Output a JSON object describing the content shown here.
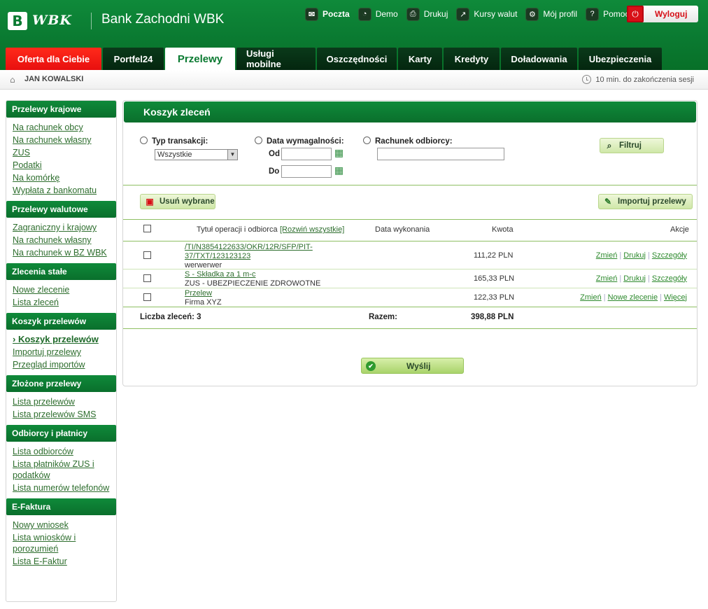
{
  "header": {
    "logo_mark": "B",
    "logo_text": "WBK",
    "bank_name": "Bank Zachodni WBK",
    "top_links": [
      {
        "label": "Poczta",
        "icon": "envelope-icon",
        "glyph": "✉",
        "bold": true
      },
      {
        "label": "Demo",
        "icon": "demo-icon",
        "glyph": "◔"
      },
      {
        "label": "Drukuj",
        "icon": "printer-icon",
        "glyph": "⎙"
      },
      {
        "label": "Kursy walut",
        "icon": "chart-icon",
        "glyph": "↗"
      },
      {
        "label": "Mój profil",
        "icon": "gear-icon",
        "glyph": "⚙"
      },
      {
        "label": "Pomoc",
        "icon": "help-icon",
        "glyph": "?"
      }
    ],
    "logout_label": "Wyloguj"
  },
  "tabs": [
    {
      "label": "Oferta dla Ciebie",
      "state": "offer"
    },
    {
      "label": "Portfel24"
    },
    {
      "label": "Przelewy",
      "state": "active"
    },
    {
      "label": "Usługi mobilne"
    },
    {
      "label": "Oszczędności"
    },
    {
      "label": "Karty"
    },
    {
      "label": "Kredyty"
    },
    {
      "label": "Doładowania"
    },
    {
      "label": "Ubezpieczenia"
    }
  ],
  "userbar": {
    "user_name": "JAN KOWALSKI",
    "session": "10 min. do zakończenia sesji"
  },
  "sidebar": [
    {
      "title": "Przelewy krajowe",
      "items": [
        "Na rachunek obcy",
        "Na rachunek własny",
        "ZUS",
        "Podatki",
        "Na komórkę",
        "Wypłata z bankomatu"
      ]
    },
    {
      "title": "Przelewy walutowe",
      "items": [
        "Zagraniczny i krajowy",
        "Na rachunek własny",
        "Na rachunek w BZ WBK"
      ]
    },
    {
      "title": "Zlecenia stałe",
      "items": [
        "Nowe zlecenie",
        "Lista zleceń"
      ]
    },
    {
      "title": "Koszyk przelewów",
      "items": [
        "Koszyk przelewów",
        "Importuj przelewy",
        "Przegląd importów"
      ],
      "current": 0
    },
    {
      "title": "Złożone przelewy",
      "items": [
        "Lista przelewów",
        "Lista przelewów SMS"
      ]
    },
    {
      "title": "Odbiorcy i płatnicy",
      "items": [
        "Lista odbiorców",
        "Lista płatników ZUS i podatków",
        "Lista numerów telefonów"
      ]
    },
    {
      "title": "E-Faktura",
      "items": [
        "Nowy wniosek",
        "Lista wniosków i porozumień",
        "Lista E-Faktur"
      ]
    }
  ],
  "main": {
    "title": "Koszyk zleceń",
    "filters": {
      "type_label": "Typ transakcji:",
      "type_value": "Wszystkie",
      "date_label": "Data wymagalności:",
      "from_label": "Od",
      "to_label": "Do",
      "account_label": "Rachunek odbiorcy:",
      "filter_button": "Filtruj"
    },
    "delete_button": "Usuń wybrane",
    "import_button": "Importuj przelewy",
    "columns": {
      "title": "Tytuł operacji i odbiorca",
      "expand": "[Rozwiń wszystkie]",
      "date": "Data wykonania",
      "amount": "Kwota",
      "actions": "Akcje"
    },
    "rows": [
      {
        "title_line1": "/TI/N3854122633/OKR/12R/SFP/PIT-",
        "title_line2": "37/TXT/123123123",
        "recipient": "werwerwer",
        "amount": "111,22 PLN",
        "actions": [
          "Zmień",
          "Drukuj",
          "Szczegóły"
        ]
      },
      {
        "title_line1": "S - Składka za 1 m-c",
        "title_line2": "",
        "recipient": "ZUS - UBEZPIECZENIE ZDROWOTNE",
        "amount": "165,33 PLN",
        "actions": [
          "Zmień",
          "Drukuj",
          "Szczegóły"
        ]
      },
      {
        "title_line1": "Przelew",
        "title_line2": "",
        "recipient": "Firma XYZ",
        "amount": "122,33 PLN",
        "actions": [
          "Zmień",
          "Nowe zlecenie",
          "Więcej"
        ]
      }
    ],
    "summary": {
      "count_label": "Liczba zleceń: 3",
      "total_label": "Razem:",
      "total_value": "398,88 PLN"
    },
    "send_button": "Wyślij"
  }
}
